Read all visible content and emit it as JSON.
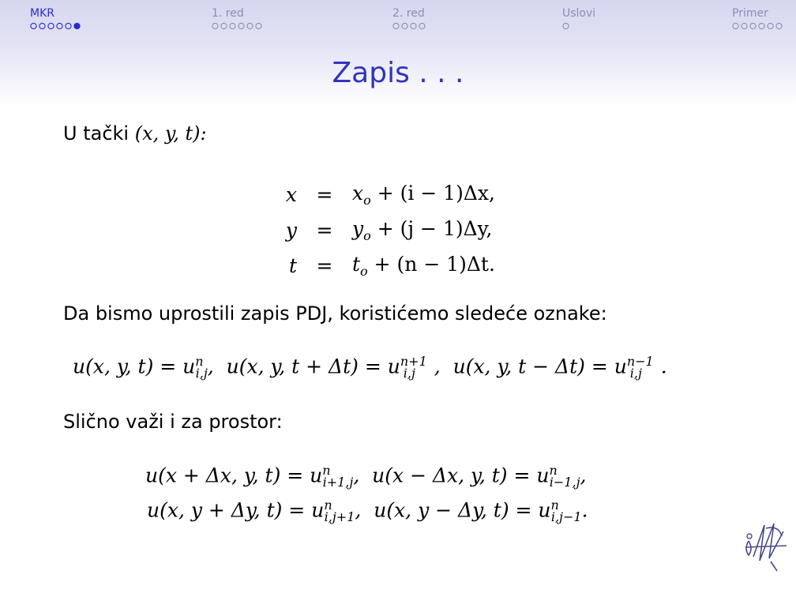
{
  "nav": {
    "sections": [
      {
        "label": "MKR",
        "dots": 6,
        "filled": 5,
        "active": true
      },
      {
        "label": "1. red",
        "dots": 6,
        "filled": -1,
        "active": false
      },
      {
        "label": "2. red",
        "dots": 4,
        "filled": -1,
        "active": false
      },
      {
        "label": "Uslovi",
        "dots": 1,
        "filled": -1,
        "active": false
      },
      {
        "label": "Primer",
        "dots": 6,
        "filled": -1,
        "active": false
      }
    ]
  },
  "slide": {
    "title": "Zapis . . .",
    "intro": "U tački",
    "point": "(x, y, t):",
    "equations": [
      {
        "lhs": "x",
        "op": "=",
        "rhs_var": "x",
        "rhs_sub": "o",
        "rhs_rest": " + (i − 1)Δx,"
      },
      {
        "lhs": "y",
        "op": "=",
        "rhs_var": "y",
        "rhs_sub": "o",
        "rhs_rest": " + (j − 1)Δy,"
      },
      {
        "lhs": "t",
        "op": "=",
        "rhs_var": "t",
        "rhs_sub": "o",
        "rhs_rest": " + (n − 1)Δt."
      }
    ],
    "sentence1": "Da bismo uprostili zapis PDJ, koristićemo sledeće oznake:",
    "sentence2": "Slično važi i za prostor:"
  },
  "colors": {
    "accent": "#3333bb",
    "nav_active": "#2b2bd3",
    "nav_inactive": "#8c8cb8"
  },
  "icons": {
    "logo": "university-logo-icon"
  }
}
